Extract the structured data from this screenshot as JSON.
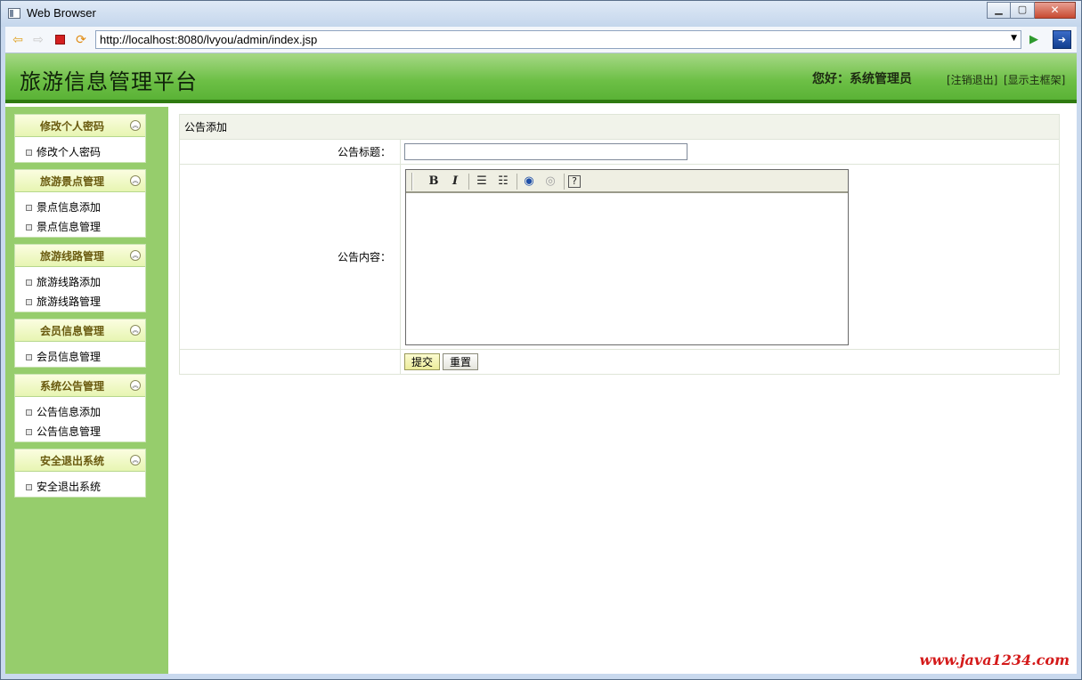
{
  "window": {
    "title": "Web Browser",
    "url": "http://localhost:8080/lvyou/admin/index.jsp"
  },
  "header": {
    "site_title": "旅游信息管理平台",
    "greeting": "您好：系统管理员",
    "logout": "[注销退出]",
    "show_frame": "[显示主框架]"
  },
  "sidebar": {
    "groups": [
      {
        "title": "修改个人密码",
        "items": [
          "修改个人密码"
        ]
      },
      {
        "title": "旅游景点管理",
        "items": [
          "景点信息添加",
          "景点信息管理"
        ]
      },
      {
        "title": "旅游线路管理",
        "items": [
          "旅游线路添加",
          "旅游线路管理"
        ]
      },
      {
        "title": "会员信息管理",
        "items": [
          "会员信息管理"
        ]
      },
      {
        "title": "系统公告管理",
        "items": [
          "公告信息添加",
          "公告信息管理"
        ]
      },
      {
        "title": "安全退出系统",
        "items": [
          "安全退出系统"
        ]
      }
    ]
  },
  "form": {
    "caption": "公告添加",
    "title_label": "公告标题：",
    "title_value": "",
    "content_label": "公告内容：",
    "submit_label": "提交",
    "reset_label": "重置",
    "toolbar": {
      "bold": "B",
      "italic": "I"
    }
  },
  "watermark": "www.java1234.com",
  "colors": {
    "sidebar_bg": "#96cd6c",
    "header_green": "#6cbf45",
    "watermark_red": "#d41a1a"
  }
}
